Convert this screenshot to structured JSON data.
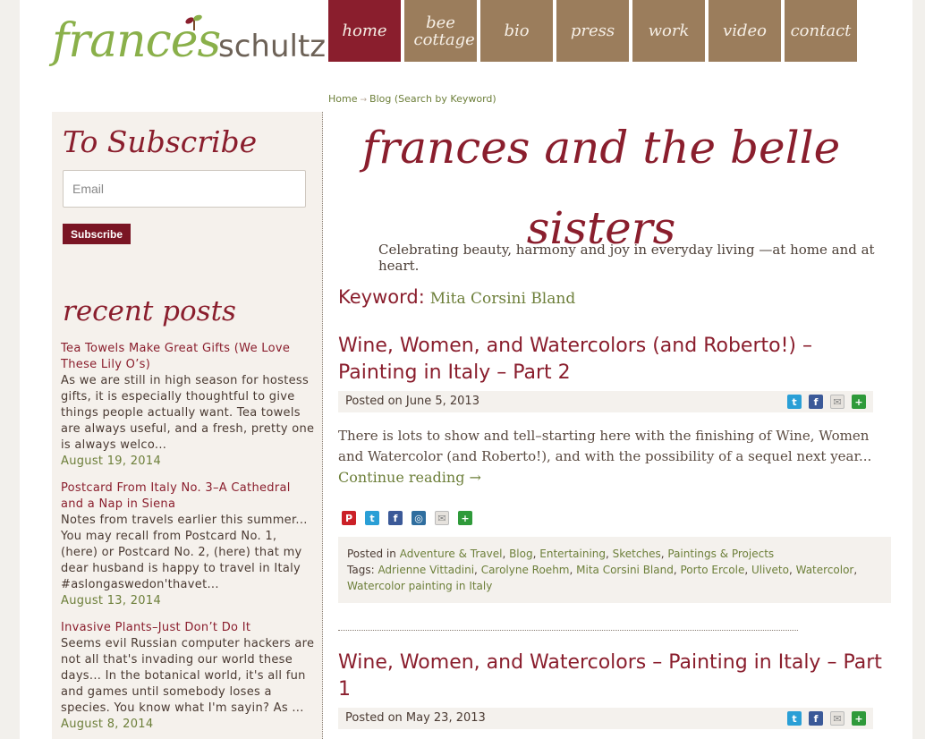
{
  "logo": {
    "part1": "frances",
    "part2": "schultz"
  },
  "nav": [
    {
      "label": "home",
      "active": true
    },
    {
      "label": "bee cottage",
      "active": false
    },
    {
      "label": "bio",
      "active": false
    },
    {
      "label": "press",
      "active": false
    },
    {
      "label": "work",
      "active": false
    },
    {
      "label": "video",
      "active": false
    },
    {
      "label": "contact",
      "active": false
    }
  ],
  "breadcrumb": {
    "home": "Home",
    "current": "Blog (Search by Keyword)"
  },
  "sidebar": {
    "subscribe_title": "To Subscribe",
    "email_placeholder": "Email",
    "subscribe_button": "Subscribe",
    "recent_title": "recent posts",
    "posts": [
      {
        "title": "Tea Towels Make Great Gifts (We Love These Lily O’s)",
        "excerpt": "As we are still in high season for hostess gifts, it is especially thoughtful to give things  people actually want. Tea towels are always useful, and a fresh, pretty one is always welco...",
        "date": "August 19, 2014"
      },
      {
        "title": "Postcard From Italy No. 3–A Cathedral and a Nap in Siena",
        "excerpt": " Notes from travels earlier this summer... You may recall from Postcard No. 1, (here) or Postcard No. 2, (here) that my dear husband is happy to travel in Italy #aslongaswedon'thavet...",
        "date": "August 13, 2014"
      },
      {
        "title": "Invasive Plants–Just Don’t Do It",
        "excerpt": "Seems evil Russian computer hackers are not all that's invading our world these days... In the botanical world, it's all fun and games until somebody loses a species. You know what I'm sayin? As ...",
        "date": "August 8, 2014"
      }
    ]
  },
  "main": {
    "blog_title": "frances and the belle sisters",
    "tagline": "Celebrating beauty, harmony and joy in everyday living —at home and at heart.",
    "keyword_label": "Keyword:",
    "keyword_value": "Mita Corsini Bland",
    "articles": [
      {
        "title": "Wine, Women, and Watercolors (and Roberto!) – Painting in Italy – Part 2",
        "posted": "Posted on June 5, 2013",
        "body": "There is lots to show and tell–starting here with the finishing of Wine, Women and Watercolor (and Roberto!), and with the possibility of a sequel next year...",
        "continue": "Continue reading →",
        "posted_in_label": "Posted in",
        "categories": [
          "Adventure & Travel",
          "Blog",
          "Entertaining",
          "Sketches",
          "Paintings & Projects"
        ],
        "tags_label": "Tags:",
        "tags": [
          "Adrienne Vittadini",
          "Carolyne Roehm",
          "Mita Corsini Bland",
          "Porto Ercole",
          "Uliveto",
          "Watercolor",
          "Watercolor painting in Italy"
        ]
      },
      {
        "title": "Wine, Women, and Watercolors – Painting in Italy – Part 1",
        "posted": "Posted on May 23, 2013"
      }
    ]
  },
  "icons": {
    "twitter": "t",
    "facebook": "f",
    "mail": "✉",
    "share": "+",
    "pinterest": "P",
    "instagram": "◎"
  },
  "colors": {
    "accent": "#8a1e2d",
    "green": "#6d7f3a",
    "nav": "#9b7d5c"
  }
}
